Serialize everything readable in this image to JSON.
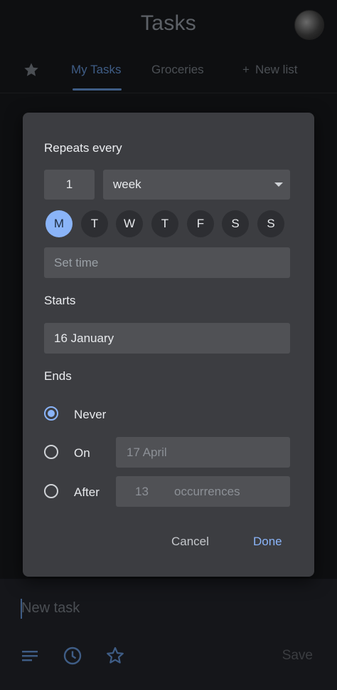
{
  "header": {
    "title": "Tasks"
  },
  "tabs": [
    {
      "label": "★",
      "icon": "star-icon"
    },
    {
      "label": "My Tasks"
    },
    {
      "label": "Groceries"
    },
    {
      "label": "New list"
    }
  ],
  "dialog": {
    "repeats_label": "Repeats every",
    "interval_value": "1",
    "interval_unit": "week",
    "days": [
      "M",
      "T",
      "W",
      "T",
      "F",
      "S",
      "S"
    ],
    "selected_day": "M",
    "set_time_placeholder": "Set time",
    "starts_label": "Starts",
    "starts_value": "16 January",
    "ends_label": "Ends",
    "ends_options": {
      "never": "Never",
      "on": "On",
      "on_date": "17 April",
      "after": "After",
      "after_count": "13",
      "after_unit": "occurrences"
    },
    "selected_end": "never",
    "cancel_label": "Cancel",
    "done_label": "Done"
  },
  "bottom": {
    "new_task_placeholder": "New task",
    "save_label": "Save",
    "icons": [
      "details-icon",
      "clock-icon",
      "star-icon"
    ]
  },
  "colors": {
    "accent": "#8ab4f8",
    "dialog_bg": "#3c3d41",
    "field_bg": "#505155",
    "page_bg": "#0e0f11"
  }
}
